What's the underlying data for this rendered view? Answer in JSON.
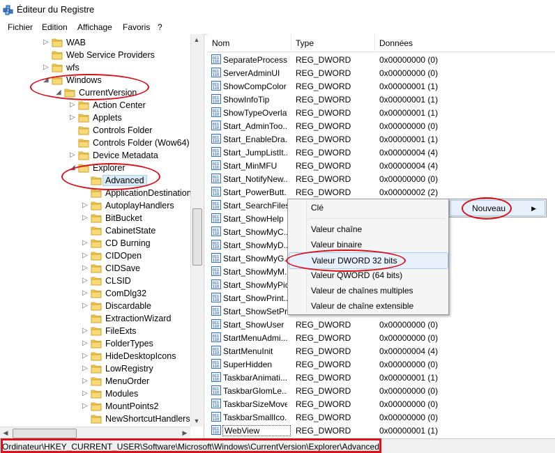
{
  "window": {
    "title": "Éditeur du Registre",
    "icon": "registry-editor-icon"
  },
  "menu": [
    "Fichier",
    "Edition",
    "Affichage",
    "Favoris",
    "?"
  ],
  "tree": {
    "items": [
      {
        "label": "WAB",
        "level": 0,
        "expander": "collapsed"
      },
      {
        "label": "Web Service Providers",
        "level": 0,
        "expander": "none"
      },
      {
        "label": "wfs",
        "level": 0,
        "expander": "collapsed"
      },
      {
        "label": "Windows",
        "level": 0,
        "expander": "expanded"
      },
      {
        "label": "CurrentVersion",
        "level": 1,
        "expander": "expanded"
      },
      {
        "label": "Action Center",
        "level": 2,
        "expander": "collapsed"
      },
      {
        "label": "Applets",
        "level": 2,
        "expander": "collapsed"
      },
      {
        "label": "Controls Folder",
        "level": 2,
        "expander": "none"
      },
      {
        "label": "Controls Folder (Wow64)",
        "level": 2,
        "expander": "none"
      },
      {
        "label": "Device Metadata",
        "level": 2,
        "expander": "collapsed"
      },
      {
        "label": "Explorer",
        "level": 2,
        "expander": "expanded"
      },
      {
        "label": "Advanced",
        "level": 3,
        "expander": "none",
        "selected": true
      },
      {
        "label": "ApplicationDestination",
        "level": 3,
        "expander": "none"
      },
      {
        "label": "AutoplayHandlers",
        "level": 3,
        "expander": "collapsed"
      },
      {
        "label": "BitBucket",
        "level": 3,
        "expander": "collapsed"
      },
      {
        "label": "CabinetState",
        "level": 3,
        "expander": "none"
      },
      {
        "label": "CD Burning",
        "level": 3,
        "expander": "collapsed"
      },
      {
        "label": "CIDOpen",
        "level": 3,
        "expander": "collapsed"
      },
      {
        "label": "CIDSave",
        "level": 3,
        "expander": "collapsed"
      },
      {
        "label": "CLSID",
        "level": 3,
        "expander": "collapsed"
      },
      {
        "label": "ComDlg32",
        "level": 3,
        "expander": "collapsed"
      },
      {
        "label": "Discardable",
        "level": 3,
        "expander": "collapsed"
      },
      {
        "label": "ExtractionWizard",
        "level": 3,
        "expander": "none"
      },
      {
        "label": "FileExts",
        "level": 3,
        "expander": "collapsed"
      },
      {
        "label": "FolderTypes",
        "level": 3,
        "expander": "collapsed"
      },
      {
        "label": "HideDesktopIcons",
        "level": 3,
        "expander": "collapsed"
      },
      {
        "label": "LowRegistry",
        "level": 3,
        "expander": "collapsed"
      },
      {
        "label": "MenuOrder",
        "level": 3,
        "expander": "collapsed"
      },
      {
        "label": "Modules",
        "level": 3,
        "expander": "collapsed"
      },
      {
        "label": "MountPoints2",
        "level": 3,
        "expander": "collapsed"
      },
      {
        "label": "NewShortcutHandlers",
        "level": 3,
        "expander": "none"
      }
    ]
  },
  "list": {
    "columns": [
      "Nom",
      "Type",
      "Données"
    ],
    "rows": [
      {
        "name": "SeparateProcess",
        "type": "REG_DWORD",
        "data": "0x00000000 (0)"
      },
      {
        "name": "ServerAdminUI",
        "type": "REG_DWORD",
        "data": "0x00000000 (0)"
      },
      {
        "name": "ShowCompColor",
        "type": "REG_DWORD",
        "data": "0x00000001 (1)"
      },
      {
        "name": "ShowInfoTip",
        "type": "REG_DWORD",
        "data": "0x00000001 (1)"
      },
      {
        "name": "ShowTypeOverlay",
        "type": "REG_DWORD",
        "data": "0x00000001 (1)"
      },
      {
        "name": "Start_AdminToo...",
        "type": "REG_DWORD",
        "data": "0x00000000 (0)"
      },
      {
        "name": "Start_EnableDra...",
        "type": "REG_DWORD",
        "data": "0x00000001 (1)"
      },
      {
        "name": "Start_JumpListIt...",
        "type": "REG_DWORD",
        "data": "0x00000004 (4)"
      },
      {
        "name": "Start_MinMFU",
        "type": "REG_DWORD",
        "data": "0x00000004 (4)"
      },
      {
        "name": "Start_NotifyNew...",
        "type": "REG_DWORD",
        "data": "0x00000000 (0)"
      },
      {
        "name": "Start_PowerButt...",
        "type": "REG_DWORD",
        "data": "0x00000002 (2)"
      },
      {
        "name": "Start_SearchFiles",
        "type": "",
        "data": ""
      },
      {
        "name": "Start_ShowHelp",
        "type": "",
        "data": ""
      },
      {
        "name": "Start_ShowMyC...",
        "type": "",
        "data": ""
      },
      {
        "name": "Start_ShowMyD...",
        "type": "",
        "data": ""
      },
      {
        "name": "Start_ShowMyG...",
        "type": "",
        "data": ""
      },
      {
        "name": "Start_ShowMyM...",
        "type": "",
        "data": ""
      },
      {
        "name": "Start_ShowMyPic",
        "type": "",
        "data": ""
      },
      {
        "name": "Start_ShowPrint...",
        "type": "",
        "data": ""
      },
      {
        "name": "Start_ShowSetPr...",
        "type": "",
        "data": ""
      },
      {
        "name": "Start_ShowUser",
        "type": "REG_DWORD",
        "data": "0x00000000 (0)"
      },
      {
        "name": "StartMenuAdmi...",
        "type": "REG_DWORD",
        "data": "0x00000000 (0)"
      },
      {
        "name": "StartMenuInit",
        "type": "REG_DWORD",
        "data": "0x00000004 (4)"
      },
      {
        "name": "SuperHidden",
        "type": "REG_DWORD",
        "data": "0x00000000 (0)"
      },
      {
        "name": "TaskbarAnimati...",
        "type": "REG_DWORD",
        "data": "0x00000001 (1)"
      },
      {
        "name": "TaskbarGlomLe...",
        "type": "REG_DWORD",
        "data": "0x00000000 (0)"
      },
      {
        "name": "TaskbarSizeMove",
        "type": "REG_DWORD",
        "data": "0x00000000 (0)"
      },
      {
        "name": "TaskbarSmallIco...",
        "type": "REG_DWORD",
        "data": "0x00000000 (0)"
      },
      {
        "name": "WebView",
        "type": "REG_DWORD",
        "data": "0x00000001 (1)",
        "selected": true
      }
    ]
  },
  "context_menu": {
    "main_item": "Nouveau",
    "submenu": [
      {
        "label": "Clé",
        "highlighted": false
      },
      {
        "separator": true
      },
      {
        "label": "Valeur chaîne",
        "highlighted": false
      },
      {
        "label": "Valeur binaire",
        "highlighted": false
      },
      {
        "label": "Valeur DWORD 32 bits",
        "highlighted": true
      },
      {
        "label": "Valeur QWORD (64 bits)",
        "highlighted": false
      },
      {
        "label": "Valeur de chaînes multiples",
        "highlighted": false
      },
      {
        "label": "Valeur de chaîne extensible",
        "highlighted": false
      }
    ]
  },
  "statusbar": {
    "path": "Ordinateur\\HKEY_CURRENT_USER\\Software\\Microsoft\\Windows\\CurrentVersion\\Explorer\\Advanced"
  },
  "colors": {
    "annotation": "#d8101a",
    "selection": "#d9ebf9",
    "folder": "#f2c94c"
  }
}
